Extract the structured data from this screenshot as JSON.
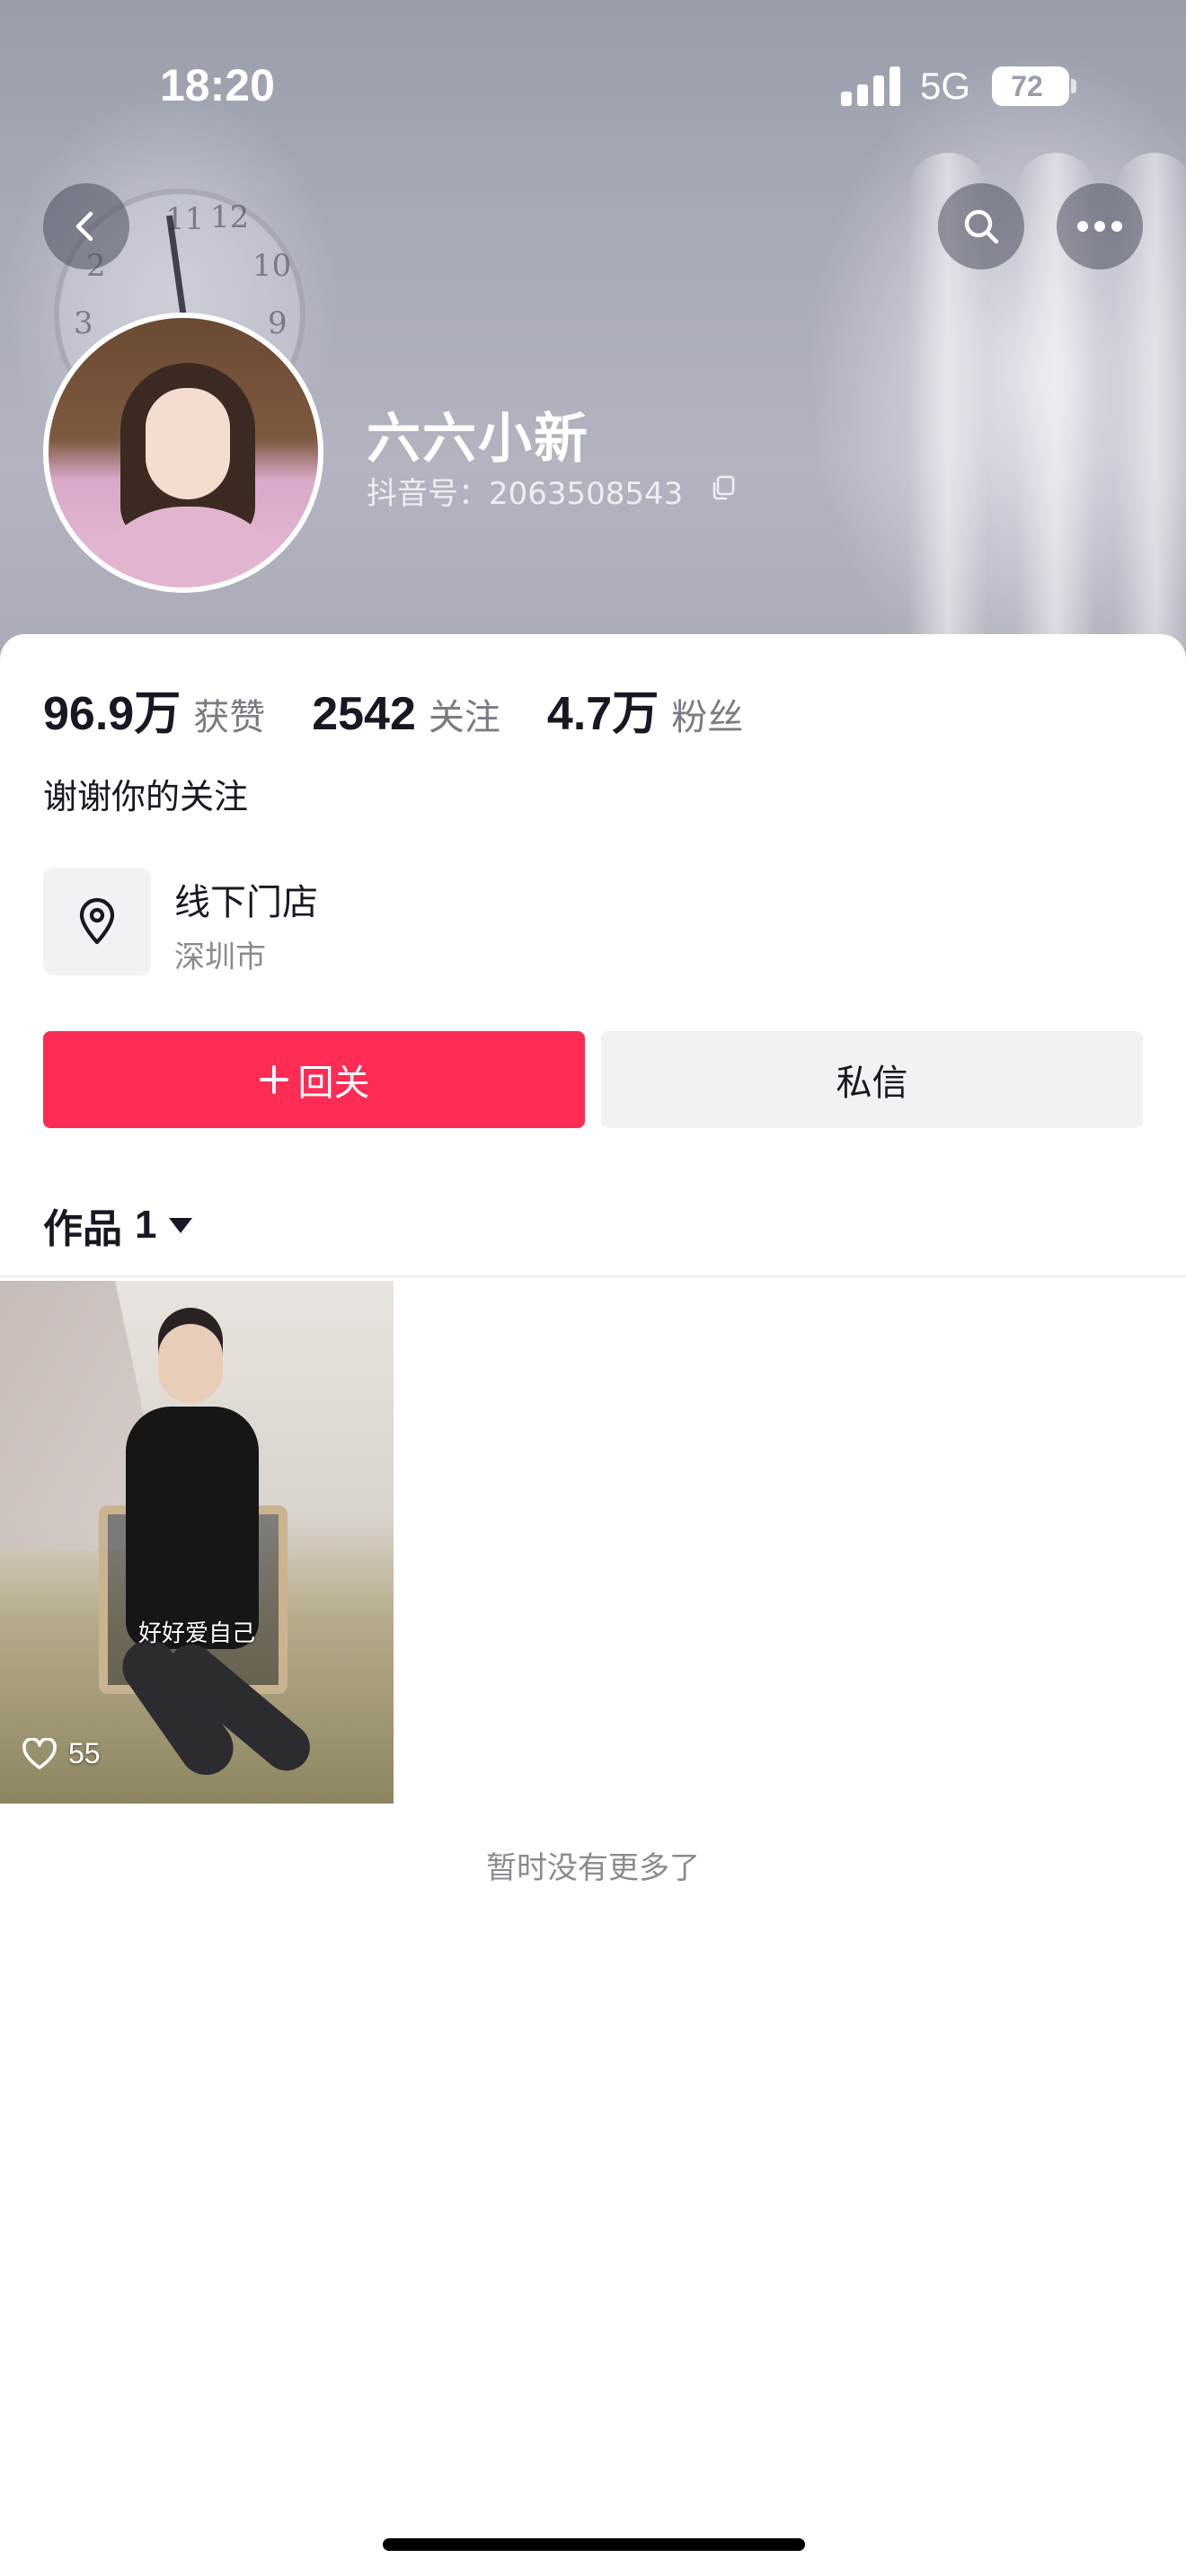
{
  "status_bar": {
    "time": "18:20",
    "network": "5G",
    "battery": "72"
  },
  "header": {
    "back_icon": "chevron-left-icon",
    "search_icon": "search-icon",
    "more_icon": "ellipsis-icon"
  },
  "profile": {
    "name": "六六小新",
    "douyin_id": "抖音号：2063508543",
    "copy_icon": "copy-icon"
  },
  "stats": [
    {
      "value": "96.9万",
      "label": "获赞"
    },
    {
      "value": "2542",
      "label": "关注"
    },
    {
      "value": "4.7万",
      "label": "粉丝"
    }
  ],
  "bio": "谢谢你的关注",
  "store": {
    "icon": "location-pin-icon",
    "title": "线下门店",
    "city": "深圳市"
  },
  "actions": {
    "follow_back": "回关",
    "message": "私信"
  },
  "works": {
    "label": "作品",
    "count": "1"
  },
  "videos": [
    {
      "caption": "好好爱自己",
      "likes": "55"
    }
  ],
  "footer": {
    "no_more": "暂时没有更多了"
  },
  "colors": {
    "accent": "#fe2c55",
    "secondary_button": "#f2f2f4",
    "text": "#161823",
    "muted_text": "#8a8b92"
  }
}
